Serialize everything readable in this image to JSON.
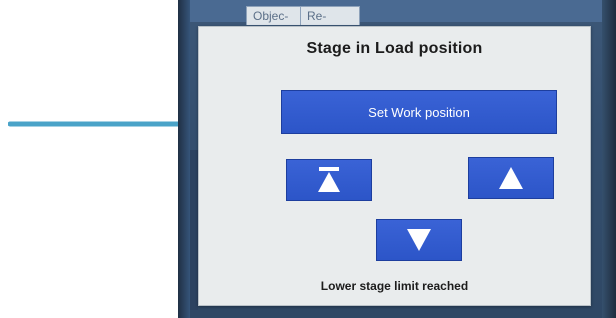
{
  "background_tabs": {
    "objective_label": "Objec-",
    "re_label": "Re-"
  },
  "dialog": {
    "title": "Stage in Load position",
    "set_work_button_label": "Set Work position",
    "status_text": "Lower stage limit reached"
  },
  "icons": {
    "top_limit": "move-to-top-limit-icon",
    "up": "arrow-up-icon",
    "down": "arrow-down-icon",
    "pointer": "pointer-arrow-icon"
  },
  "colors": {
    "arrow": "#4aa3c8",
    "button": "#2f59cc",
    "dialog_bg": "#e9eced"
  }
}
